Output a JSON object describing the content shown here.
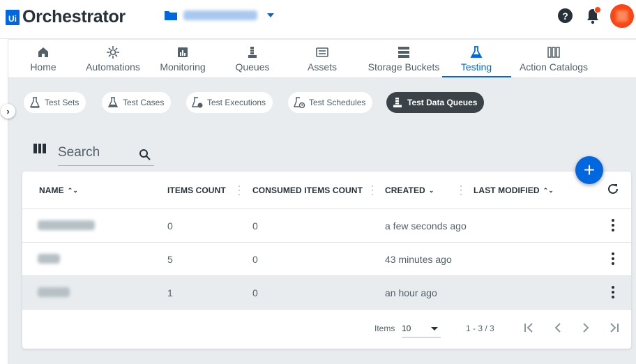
{
  "app": {
    "logo_mark": "Ui",
    "name": "Orchestrator"
  },
  "header": {
    "help_glyph": "?"
  },
  "nav": {
    "items": [
      {
        "label": "Home",
        "icon": "home-icon"
      },
      {
        "label": "Automations",
        "icon": "automations-icon"
      },
      {
        "label": "Monitoring",
        "icon": "monitoring-icon"
      },
      {
        "label": "Queues",
        "icon": "queues-icon"
      },
      {
        "label": "Assets",
        "icon": "assets-icon"
      },
      {
        "label": "Storage Buckets",
        "icon": "storage-icon"
      },
      {
        "label": "Testing",
        "icon": "testing-icon",
        "active": true
      },
      {
        "label": "Action Catalogs",
        "icon": "catalog-icon"
      }
    ]
  },
  "chips": [
    {
      "label": "Test Sets"
    },
    {
      "label": "Test Cases"
    },
    {
      "label": "Test Executions"
    },
    {
      "label": "Test Schedules"
    },
    {
      "label": "Test Data Queues",
      "active": true
    }
  ],
  "search": {
    "placeholder": "Search"
  },
  "fab": {
    "glyph": "+"
  },
  "table": {
    "columns": [
      {
        "label": "NAME",
        "sort": "⌃⌄"
      },
      {
        "label": "ITEMS COUNT"
      },
      {
        "label": "CONSUMED ITEMS COUNT"
      },
      {
        "label": "CREATED",
        "sort": "⌄"
      },
      {
        "label": "LAST MODIFIED",
        "sort": "⌃⌄"
      }
    ],
    "rows": [
      {
        "items_count": "0",
        "consumed": "0",
        "created": "a few seconds ago"
      },
      {
        "items_count": "5",
        "consumed": "0",
        "created": "43 minutes ago"
      },
      {
        "items_count": "1",
        "consumed": "0",
        "created": "an hour ago"
      }
    ]
  },
  "pagination": {
    "items_label": "Items",
    "page_size": "10",
    "range": "1 - 3 / 3"
  },
  "colors": {
    "accent": "#0067df",
    "notification": "#fa4616",
    "active_chip": "#3b4349"
  }
}
